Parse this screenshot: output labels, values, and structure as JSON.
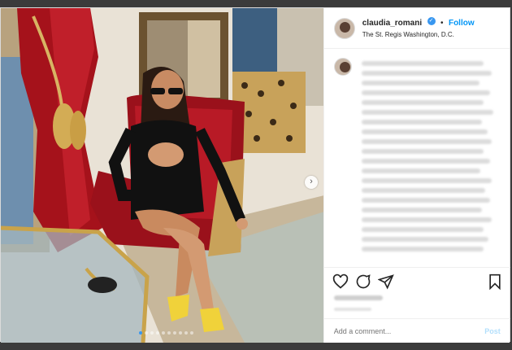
{
  "post": {
    "username": "claudia_romani",
    "verified_mark": "✓",
    "separator": "•",
    "follow_label": "Follow",
    "location": "The St. Regis Washington, D.C."
  },
  "caption": {
    "blurred_lines": 22
  },
  "comment": {
    "placeholder": "Add a comment...",
    "post_label": "Post"
  },
  "carousel": {
    "next_glyph": "›",
    "total_slides": 10,
    "active_index": 0
  },
  "icons": {
    "like": "heart-icon",
    "comment": "comment-icon",
    "share": "share-icon",
    "save": "bookmark-icon"
  },
  "colors": {
    "accent": "#0095f6",
    "verified": "#3897f0",
    "post_disabled": "#b2dffc"
  }
}
